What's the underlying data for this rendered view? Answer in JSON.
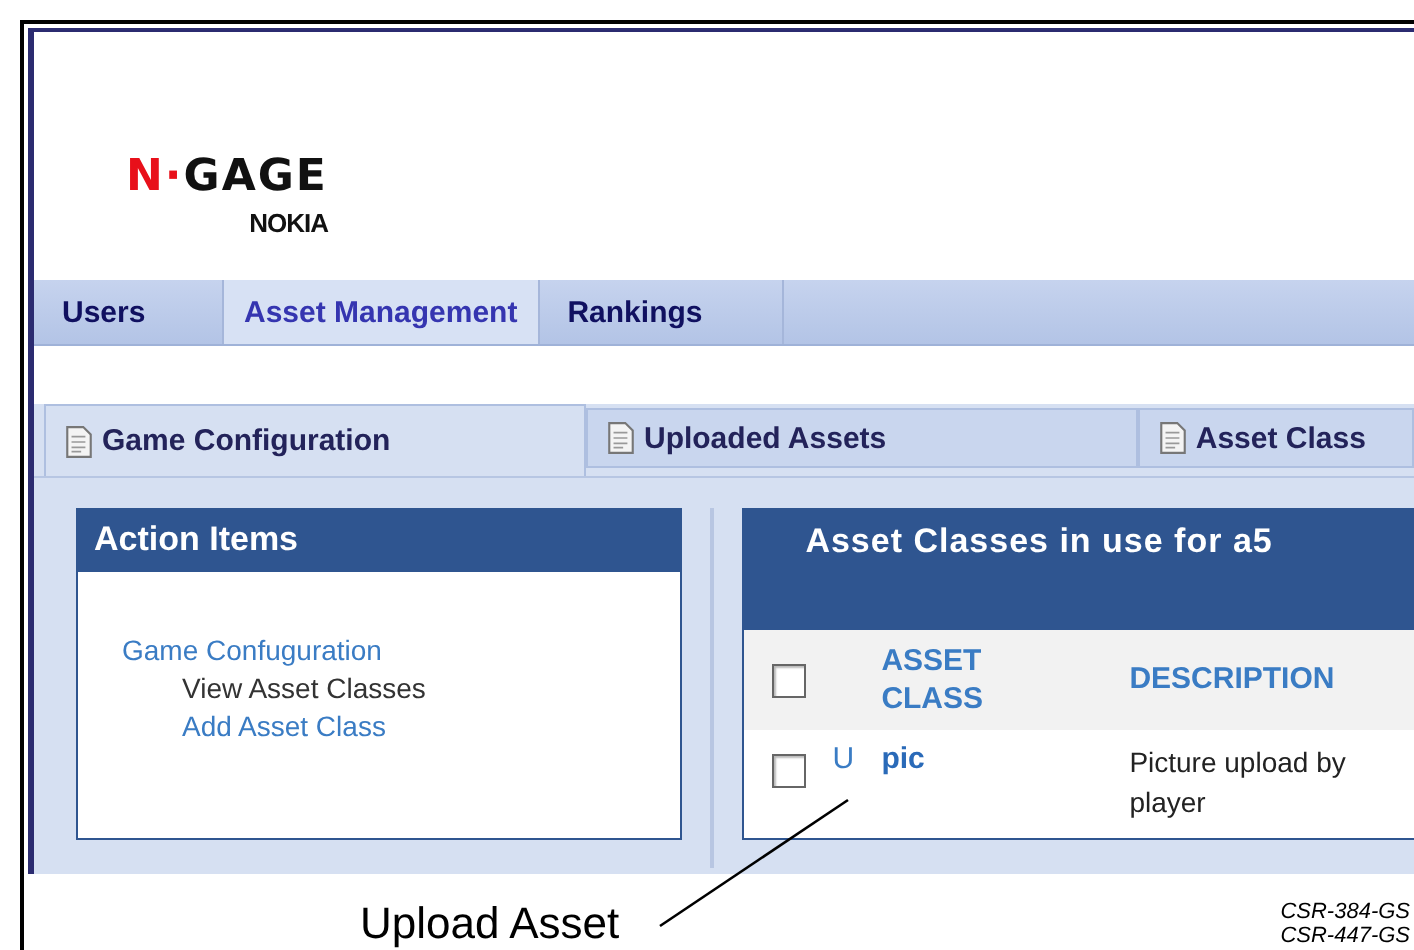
{
  "logo": {
    "wordmark_prefix": "N·",
    "wordmark": "GAGE",
    "brand": "NOKIA"
  },
  "nav_tabs": [
    {
      "label": "Users",
      "selected": false
    },
    {
      "label": "Asset Management",
      "selected": true
    },
    {
      "label": "Rankings",
      "selected": false
    }
  ],
  "sub_tabs": [
    {
      "label": "Game Configuration",
      "selected": true
    },
    {
      "label": "Uploaded Assets",
      "selected": false
    },
    {
      "label": "Asset Class",
      "selected": false
    }
  ],
  "action_items": {
    "title": "Action Items",
    "items": [
      {
        "label": "Game Confuguration",
        "kind": "link",
        "children": [
          {
            "label": "View Asset Classes",
            "kind": "current"
          },
          {
            "label": "Add Asset Class",
            "kind": "link"
          }
        ]
      }
    ]
  },
  "asset_classes": {
    "title": "Asset Classes in use for a5",
    "header_checked": false,
    "columns": [
      "ASSET CLASS",
      "DESCRIPTION"
    ],
    "rows": [
      {
        "checked": false,
        "action": "U",
        "asset_class": "pic",
        "description": "Picture upload by player"
      }
    ]
  },
  "callout": {
    "label": "Upload Asset"
  },
  "figure_codes": [
    "CSR-384-GS",
    "CSR-447-GS"
  ]
}
